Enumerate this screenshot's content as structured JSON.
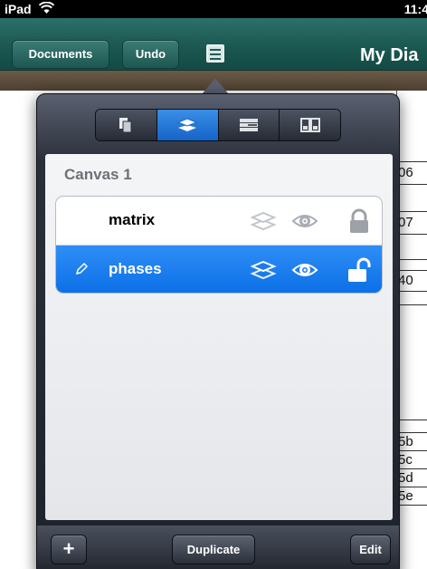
{
  "status_bar": {
    "carrier": "iPad",
    "time": "11:4"
  },
  "nav": {
    "documents_label": "Documents",
    "undo_label": "Undo",
    "title": "My Dia"
  },
  "sheet_cells": [
    "06",
    "07",
    "40",
    "5b",
    "5c",
    "5d",
    "5e"
  ],
  "popover": {
    "tabs": [
      {
        "icon": "pages-icon",
        "active": false
      },
      {
        "icon": "layers-icon",
        "active": true
      },
      {
        "icon": "properties-icon",
        "active": false
      },
      {
        "icon": "templates-icon",
        "active": false
      }
    ],
    "canvas_name": "Canvas 1",
    "layers": [
      {
        "name": "matrix",
        "selected": false,
        "visible": true,
        "locked": true
      },
      {
        "name": "phases",
        "selected": true,
        "visible": true,
        "locked": false
      }
    ],
    "toolbar": {
      "add_label": "+",
      "duplicate_label": "Duplicate",
      "edit_label": "Edit"
    }
  },
  "colors": {
    "selection": "#1a7ef0",
    "navbar": "#1c5a53"
  }
}
